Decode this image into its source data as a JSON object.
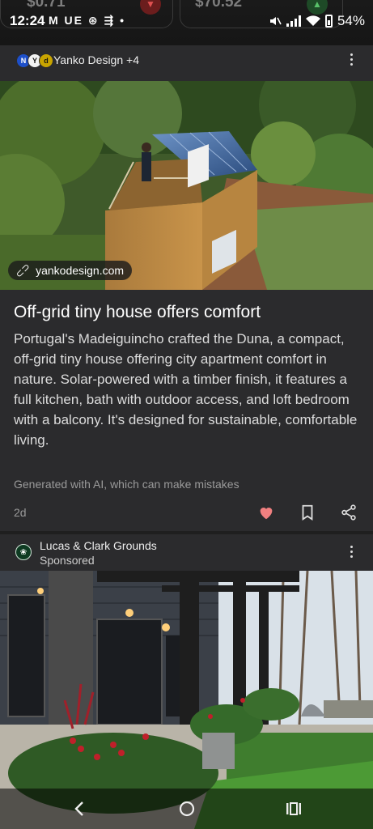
{
  "status_bar": {
    "time": "12:24",
    "left_icons": "M UE ⊛ ⇶ •",
    "battery": "54%",
    "tickers": [
      {
        "value": "$0.71",
        "direction": "down"
      },
      {
        "value": "$70.52",
        "direction": "up"
      }
    ]
  },
  "article": {
    "source_logos": [
      "N",
      "Y",
      "d"
    ],
    "source": "Yanko Design +4",
    "image_link": "yankodesign.com",
    "headline": "Off-grid tiny house offers comfort",
    "summary": "Portugal's Madeiguincho crafted the Duna, a compact, off-grid tiny house offering city apartment comfort in nature. Solar-powered with a timber finish, it features a full kitchen, bath with outdoor access, and loft bedroom with a balcony. It's designed for sustainable, comfortable living.",
    "disclaimer": "Generated with AI, which can make mistakes",
    "age": "2d",
    "liked": true,
    "icons": [
      "heart-icon",
      "bookmark-icon",
      "share-icon"
    ]
  },
  "ad": {
    "advertiser": "Lucas & Clark Grounds",
    "label": "Sponsored"
  },
  "colors": {
    "background": "#1f1f1f",
    "card": "#2b2b2d",
    "heart": "#f08080"
  }
}
